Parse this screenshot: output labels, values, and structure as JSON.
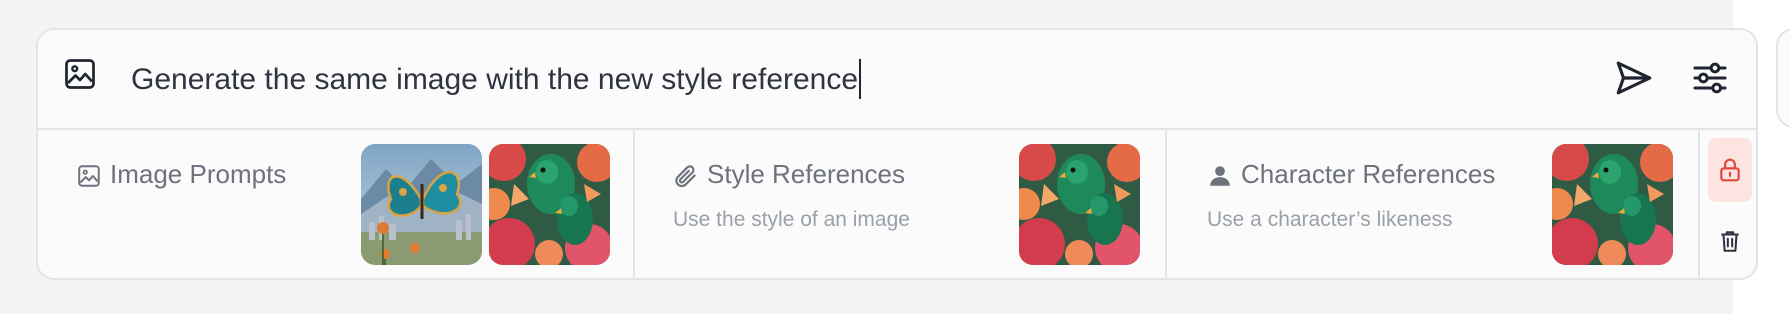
{
  "prompt": {
    "value": "Generate the same image with the new style reference",
    "image_icon": "image-icon",
    "send_icon": "send-icon",
    "settings_icon": "sliders-icon"
  },
  "references": {
    "image_prompts": {
      "label": "Image Prompts",
      "icon": "image-icon",
      "thumbnails": [
        "butterfly-thumbnail",
        "parrots-thumbnail"
      ]
    },
    "style": {
      "label": "Style References",
      "subtitle": "Use the style of an image",
      "icon": "paperclip-icon",
      "thumbnails": [
        "parrots-thumbnail"
      ]
    },
    "character": {
      "label": "Character References",
      "subtitle": "Use a character’s likeness",
      "icon": "person-icon",
      "thumbnails": [
        "parrots-thumbnail"
      ]
    }
  },
  "actions": {
    "lock_icon": "lock-icon",
    "trash_icon": "trash-icon"
  },
  "colors": {
    "lock_bg": "#fde4e1",
    "lock_icon": "#e0483c",
    "text": "#2f3440",
    "muted": "#6d727c"
  }
}
